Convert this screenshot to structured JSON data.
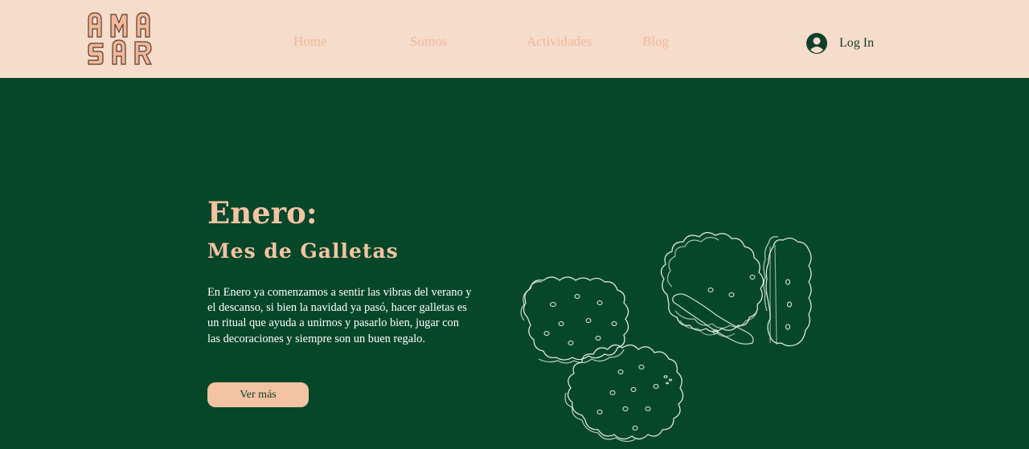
{
  "header": {
    "logo": {
      "text": "AMASAR",
      "icon": "amasar-cookie-letters-logo"
    },
    "nav": {
      "home": "Home",
      "somos": "Somos",
      "actividades": "Actividades",
      "blog": "Blog"
    },
    "login": {
      "label": "Log In",
      "icon": "user-avatar-icon"
    }
  },
  "hero": {
    "title": "Enero:",
    "subtitle": "Mes de Galletas",
    "body": "En Enero ya comenzamos a sentir las vibras del verano y el descanso, si bien la navidad ya pasó, hacer galletas es un ritual que ayuda a unirnos y pasarlo bien, jugar con las decoraciones y siempre son un buen regalo.",
    "cta_label": "Ver más",
    "illustration_icon": "cookies-line-drawing-icon"
  },
  "colors": {
    "header_bg": "#f6dccb",
    "hero_bg": "#06472a",
    "accent_peach": "#f3c3a4",
    "nav_text": "#f1b89a",
    "dark_text": "#0f3f2a",
    "body_text": "#ffffff"
  }
}
